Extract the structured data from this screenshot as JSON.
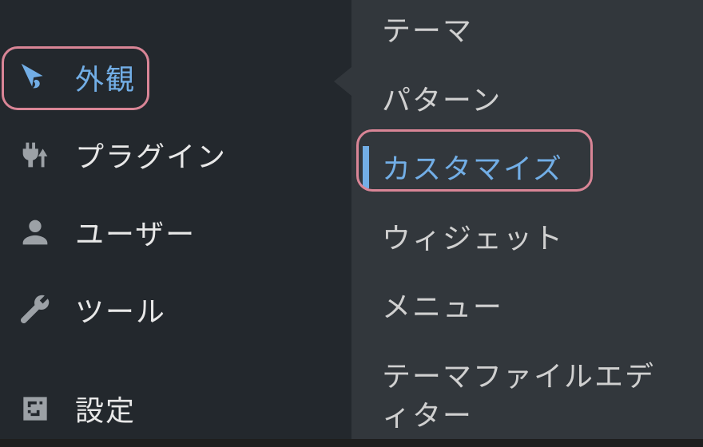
{
  "colors": {
    "sidebar_bg": "#23282d",
    "submenu_bg": "#32373c",
    "text": "#e8e8e8",
    "text_muted": "#d0d0d0",
    "accent": "#72aee6",
    "highlight_border": "#d98596"
  },
  "sidebar": {
    "items": [
      {
        "id": "appearance",
        "label": "外観",
        "icon": "brush-icon",
        "active": true
      },
      {
        "id": "plugins",
        "label": "プラグイン",
        "icon": "plug-icon",
        "active": false
      },
      {
        "id": "users",
        "label": "ユーザー",
        "icon": "user-icon",
        "active": false
      },
      {
        "id": "tools",
        "label": "ツール",
        "icon": "wrench-icon",
        "active": false
      },
      {
        "id": "settings",
        "label": "設定",
        "icon": "sliders-icon",
        "active": false
      }
    ]
  },
  "submenu": {
    "parent": "appearance",
    "items": [
      {
        "id": "themes",
        "label": "テーマ",
        "active": false
      },
      {
        "id": "patterns",
        "label": "パターン",
        "active": false
      },
      {
        "id": "customize",
        "label": "カスタマイズ",
        "active": true
      },
      {
        "id": "widgets",
        "label": "ウィジェット",
        "active": false
      },
      {
        "id": "menus",
        "label": "メニュー",
        "active": false
      },
      {
        "id": "theme-file-editor",
        "label": "テーマファイルエディター",
        "active": false
      }
    ]
  }
}
